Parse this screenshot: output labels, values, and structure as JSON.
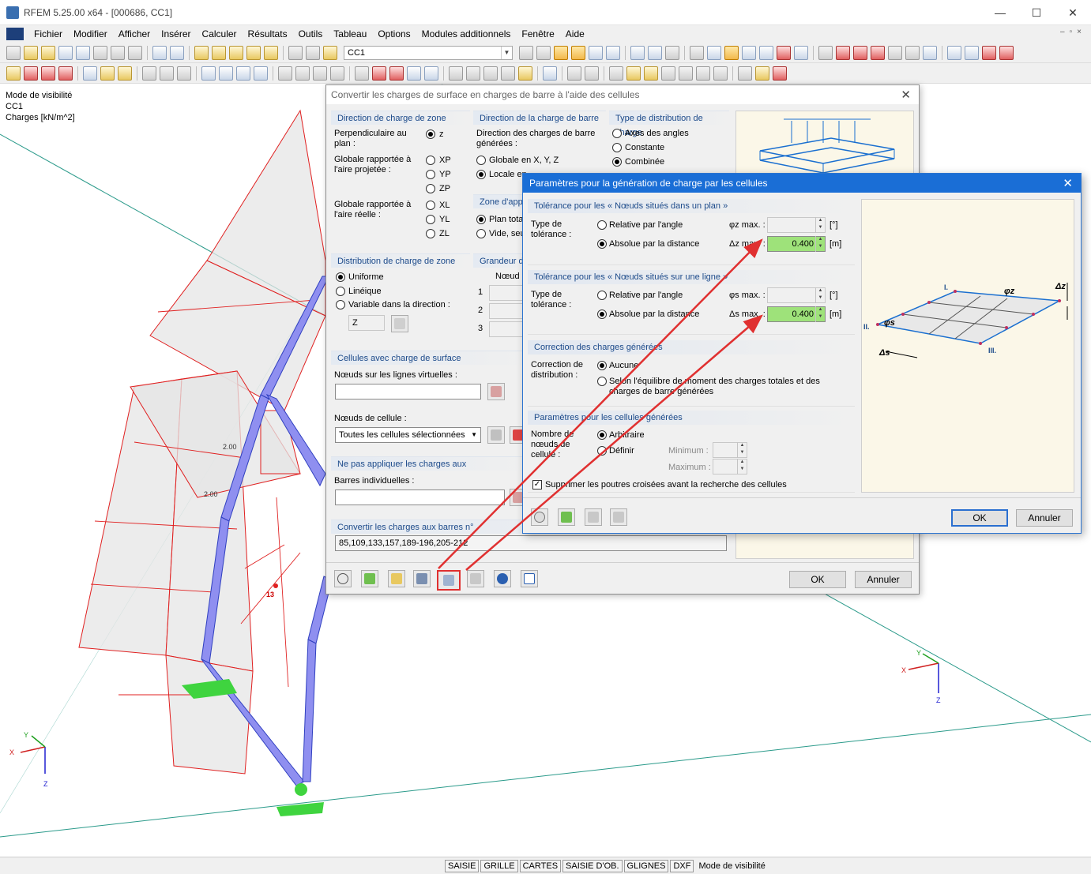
{
  "app": {
    "title": "RFEM 5.25.00 x64 - [000686, CC1]",
    "window_buttons": [
      "—",
      "☐",
      "✕"
    ]
  },
  "menu": [
    "Fichier",
    "Modifier",
    "Afficher",
    "Insérer",
    "Calculer",
    "Résultats",
    "Outils",
    "Tableau",
    "Options",
    "Modules additionnels",
    "Fenêtre",
    "Aide"
  ],
  "toolbar": {
    "loadcase": "CC1"
  },
  "viewport": {
    "info": [
      "Mode de visibilité",
      "CC1",
      "Charges [kN/m^2]"
    ],
    "load_labels": [
      "2.00",
      "2.00"
    ],
    "node_label": "13",
    "axes_left": {
      "x": "X",
      "y": "Y",
      "z": "Z"
    },
    "axes_right": {
      "x": "X",
      "y": "Y",
      "z": "Z"
    }
  },
  "statusbar": {
    "buttons": [
      "SAISIE",
      "GRILLE",
      "CARTES",
      "SAISIE D'OB.",
      "GLIGNES",
      "DXF"
    ],
    "text": "Mode de visibilité"
  },
  "dialog1": {
    "title": "Convertir les charges de surface en charges de barre à l'aide des cellules",
    "zone_dir": {
      "header": "Direction de charge de zone",
      "perp_label": "Perpendiculaire au plan :",
      "proj_label": "Globale rapportée à l'aire projetée :",
      "real_label": "Globale rapportée à l'aire réelle :",
      "opts": [
        "z",
        "XP",
        "YP",
        "ZP",
        "XL",
        "YL",
        "ZL"
      ]
    },
    "bar_dir": {
      "header": "Direction de la charge de barre",
      "text": "Direction des charges de barre générées :",
      "opt1": "Globale en X, Y, Z",
      "opt2": "Locale en"
    },
    "dist_type": {
      "header": "Type de distribution de charge",
      "opts": [
        "Axes des angles",
        "Constante",
        "Combinée"
      ]
    },
    "zone_app": {
      "header": "Zone d'appli",
      "opt1": "Plan tota",
      "opt2": "Vide, seu"
    },
    "zone_dist": {
      "header": "Distribution de charge de zone",
      "opts": [
        "Uniforme",
        "Linéique",
        "Variable dans la direction :"
      ],
      "combo": "Z"
    },
    "magnitude": {
      "header": "Grandeur de",
      "col": "Nœud n",
      "rows": [
        "1",
        "2",
        "3"
      ]
    },
    "cells": {
      "header": "Cellules avec charge de surface",
      "virt_label": "Nœuds sur les lignes virtuelles :",
      "cell_label": "Nœuds de cellule :",
      "cell_combo": "Toutes les cellules sélectionnées"
    },
    "noapply": {
      "header": "Ne pas appliquer les charges aux",
      "label": "Barres individuelles :"
    },
    "convert": {
      "header": "Convertir les charges aux barres n°",
      "value": "85,109,133,157,189-196,205-212"
    },
    "ok": "OK",
    "cancel": "Annuler"
  },
  "dialog2": {
    "title": "Paramètres pour la génération de charge par les cellules",
    "plane": {
      "header": "Tolérance pour les « Nœuds situés dans un plan »",
      "type_label": "Type de tolérance :",
      "opt_angle": "Relative par l'angle",
      "opt_dist": "Absolue par la distance",
      "phi_label": "φz max. :",
      "phi_unit": "[°]",
      "d_label": "Δz max. :",
      "d_value": "0.400",
      "d_unit": "[m]"
    },
    "line": {
      "header": "Tolérance pour les « Nœuds situés sur une ligne »",
      "type_label": "Type de tolérance :",
      "opt_angle": "Relative par l'angle",
      "opt_dist": "Absolue par la distance",
      "phi_label": "φs max. :",
      "phi_unit": "[°]",
      "d_label": "Δs max. :",
      "d_value": "0.400",
      "d_unit": "[m]"
    },
    "correction": {
      "header": "Correction des charges générées",
      "label": "Correction de distribution :",
      "opt1": "Aucune",
      "opt2": "Selon l'équilibre de moment des charges totales et des charges de barre générées"
    },
    "cellparams": {
      "header": "Paramètres pour les cellules générées",
      "label": "Nombre de nœuds de cellule :",
      "opt1": "Arbitraire",
      "opt2": "Définir",
      "min_label": "Minimum :",
      "max_label": "Maximum :",
      "chk_label": "Supprimer les poutres croisées avant la recherche des cellules"
    },
    "figure": {
      "labels": [
        "I.",
        "II.",
        "III.",
        "φz",
        "Δz",
        "φs",
        "Δs"
      ]
    },
    "ok": "OK",
    "cancel": "Annuler"
  }
}
